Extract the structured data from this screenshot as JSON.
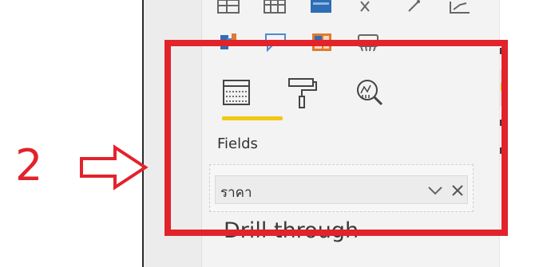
{
  "annotation": {
    "step_number": "2",
    "highlight_color": "#e2232b"
  },
  "visualizations": {
    "row1_icons": [
      "table-icon",
      "matrix-icon",
      "chart-icon",
      "key-influencers-icon",
      "decomposition-icon",
      "qa-icon"
    ],
    "row2_icons": [
      "filled-map-icon",
      "smart-narrative-icon",
      "power-apps-icon",
      "paginated-report-icon"
    ]
  },
  "tabs": [
    {
      "name": "fields-tab",
      "icon": "fields-icon",
      "active": true
    },
    {
      "name": "format-tab",
      "icon": "paint-roller-icon",
      "active": false
    },
    {
      "name": "analytics-tab",
      "icon": "analytics-magnifier-icon",
      "active": false
    }
  ],
  "active_tab_color": "#f2c811",
  "fields": {
    "label": "Fields",
    "value": "ราคา"
  },
  "drill_through": {
    "label": "Drill through"
  }
}
